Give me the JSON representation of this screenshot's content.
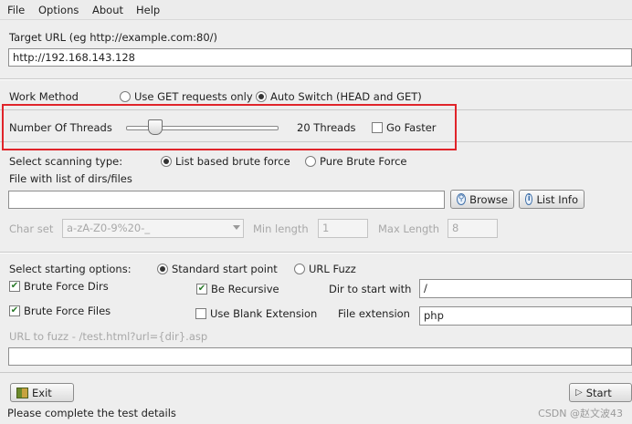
{
  "menu": {
    "file": "File",
    "options": "Options",
    "about": "About",
    "help": "Help"
  },
  "target": {
    "label": "Target URL (eg http://example.com:80/)",
    "value": "http://192.168.143.128"
  },
  "work_method": {
    "label": "Work Method",
    "get_option": "Use GET requests only",
    "auto_option": "Auto Switch (HEAD and GET)",
    "selected": "auto"
  },
  "threads": {
    "label": "Number Of Threads",
    "value_text": "20 Threads",
    "go_faster": "Go Faster",
    "go_faster_checked": false
  },
  "scan_type": {
    "label": "Select scanning type:",
    "list_option": "List based brute force",
    "pure_option": "Pure Brute Force",
    "selected": "list"
  },
  "file_list": {
    "label": "File with list of dirs/files",
    "value": "",
    "browse": "Browse",
    "list_info": "List Info"
  },
  "charset": {
    "label": "Char set",
    "value": "a-zA-Z0-9%20-_",
    "min_label": "Min length",
    "min_value": "1",
    "max_label": "Max Length",
    "max_value": "8"
  },
  "start_options": {
    "label": "Select starting options:",
    "standard": "Standard start point",
    "fuzz": "URL Fuzz",
    "selected": "standard"
  },
  "options": {
    "brute_dirs": "Brute Force Dirs",
    "brute_files": "Brute Force Files",
    "be_recursive": "Be Recursive",
    "blank_ext": "Use Blank Extension",
    "dir_start_label": "Dir to start with",
    "dir_start_value": "/",
    "file_ext_label": "File extension",
    "file_ext_value": "php"
  },
  "fuzz": {
    "label": "URL to fuzz - /test.html?url={dir}.asp",
    "value": ""
  },
  "buttons": {
    "exit": "Exit",
    "start": "Start"
  },
  "status": "Please complete the test details",
  "watermark": "CSDN @赵文波43",
  "colors": {
    "highlight": "#e0242a"
  }
}
